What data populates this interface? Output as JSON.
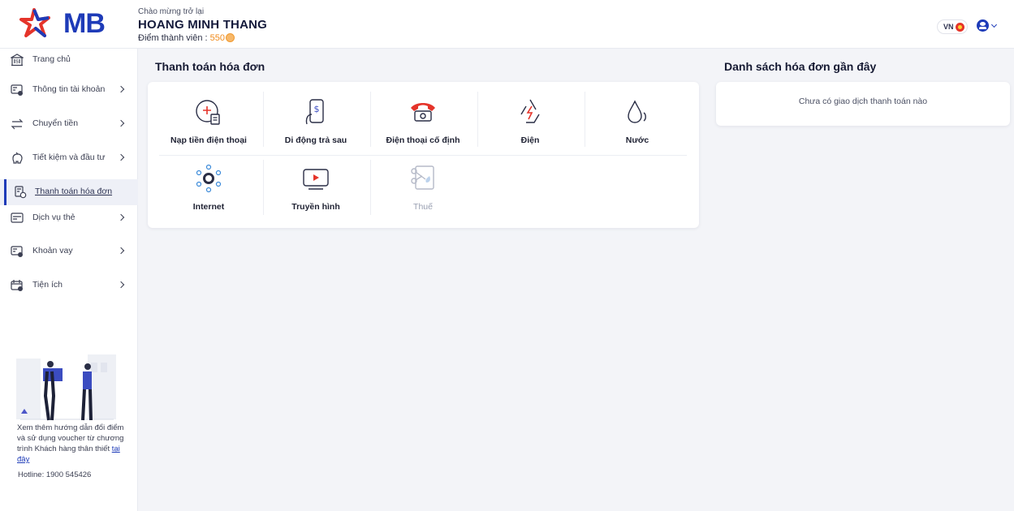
{
  "header": {
    "logo_text": "MB",
    "welcome": "Chào mừng trở lại",
    "username": "HOANG MINH THANG",
    "points_label": "Điểm thành viên : ",
    "points_value": "550",
    "lang": "VN"
  },
  "sidebar": {
    "items": [
      {
        "label": "Trang chủ",
        "icon": "bank-icon"
      },
      {
        "label": "Thông tin tài khoản",
        "icon": "account-card-icon"
      },
      {
        "label": "Chuyển tiền",
        "icon": "transfer-icon"
      },
      {
        "label": "Tiết kiệm và đầu tư",
        "icon": "piggy-bank-icon"
      },
      {
        "label": "Thanh toán hóa đơn",
        "icon": "bill-icon"
      },
      {
        "label": "Dịch vụ thẻ",
        "icon": "card-service-icon"
      },
      {
        "label": "Khoản vay",
        "icon": "loan-icon"
      },
      {
        "label": "Tiện ích",
        "icon": "utilities-icon"
      }
    ],
    "promo_text": "Xem thêm hướng dẫn đổi điểm và sử dụng voucher từ chương trình Khách hàng thân thiết ",
    "promo_link": "tại đây",
    "hotline": "Hotline: 1900 545426"
  },
  "main": {
    "title": "Thanh toán hóa đơn",
    "services": [
      {
        "label": "Nạp tiền điện thoại",
        "icon": "phone-topup-icon"
      },
      {
        "label": "Di động trả sau",
        "icon": "postpaid-mobile-icon"
      },
      {
        "label": "Điện thoại cố định",
        "icon": "landline-phone-icon"
      },
      {
        "label": "Điện",
        "icon": "electricity-icon"
      },
      {
        "label": "Nước",
        "icon": "water-drop-icon"
      },
      {
        "label": "Internet",
        "icon": "internet-globe-icon"
      },
      {
        "label": "Truyền hình",
        "icon": "tv-icon"
      },
      {
        "label": "Thuế",
        "icon": "tax-icon"
      }
    ]
  },
  "recent": {
    "title": "Danh sách hóa đơn gần đây",
    "empty": "Chưa có giao dịch thanh toán nào"
  },
  "colors": {
    "brand_blue": "#1e3bb8",
    "brand_red": "#e5342a",
    "points_orange": "#f08a1a"
  }
}
